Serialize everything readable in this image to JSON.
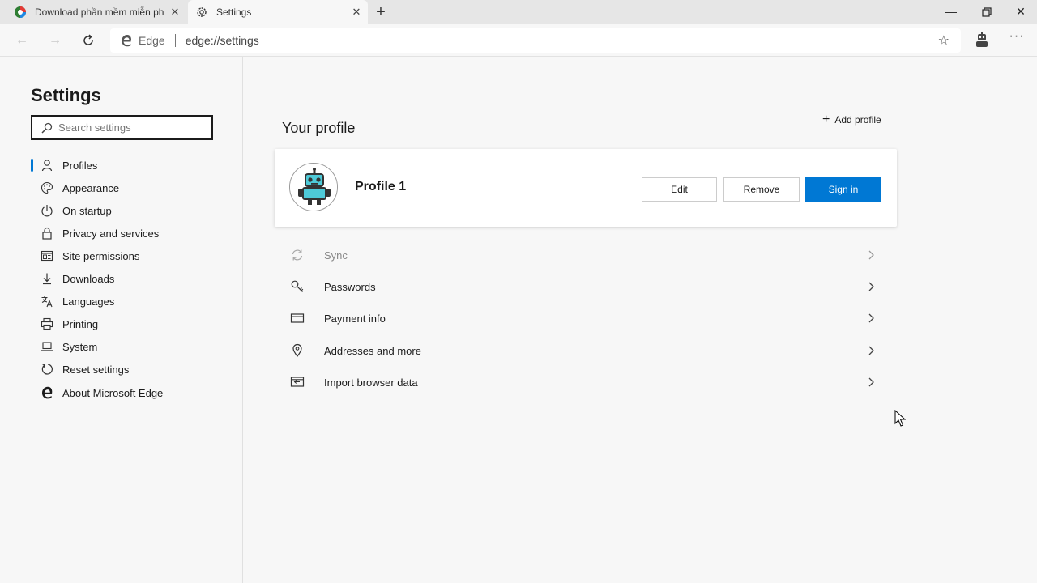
{
  "browser": {
    "tabs": [
      {
        "title": "Download phần mềm miễn phí c",
        "active": false,
        "favicon": "site-favicon-icon"
      },
      {
        "title": "Settings",
        "active": true,
        "favicon": "gear-icon"
      }
    ],
    "address": {
      "brand": "Edge",
      "url": "edge://settings"
    }
  },
  "sidebar": {
    "title": "Settings",
    "search_placeholder": "Search settings",
    "items": [
      {
        "label": "Profiles",
        "icon": "person-icon",
        "selected": true
      },
      {
        "label": "Appearance",
        "icon": "palette-icon"
      },
      {
        "label": "On startup",
        "icon": "power-icon"
      },
      {
        "label": "Privacy and services",
        "icon": "lock-icon"
      },
      {
        "label": "Site permissions",
        "icon": "site-permissions-icon"
      },
      {
        "label": "Downloads",
        "icon": "download-icon"
      },
      {
        "label": "Languages",
        "icon": "languages-icon"
      },
      {
        "label": "Printing",
        "icon": "printer-icon"
      },
      {
        "label": "System",
        "icon": "laptop-icon"
      },
      {
        "label": "Reset settings",
        "icon": "reset-icon"
      },
      {
        "label": "About Microsoft Edge",
        "icon": "edge-logo-icon"
      }
    ]
  },
  "main": {
    "section_title": "Your profile",
    "add_profile_label": "Add profile",
    "profile": {
      "name": "Profile 1",
      "edit_label": "Edit",
      "remove_label": "Remove",
      "signin_label": "Sign in"
    },
    "rows": [
      {
        "label": "Sync",
        "icon": "sync-icon",
        "disabled": true
      },
      {
        "label": "Passwords",
        "icon": "key-icon"
      },
      {
        "label": "Payment info",
        "icon": "credit-card-icon"
      },
      {
        "label": "Addresses and more",
        "icon": "location-pin-icon"
      },
      {
        "label": "Import browser data",
        "icon": "import-icon"
      }
    ]
  },
  "colors": {
    "accent": "#0078d4"
  }
}
